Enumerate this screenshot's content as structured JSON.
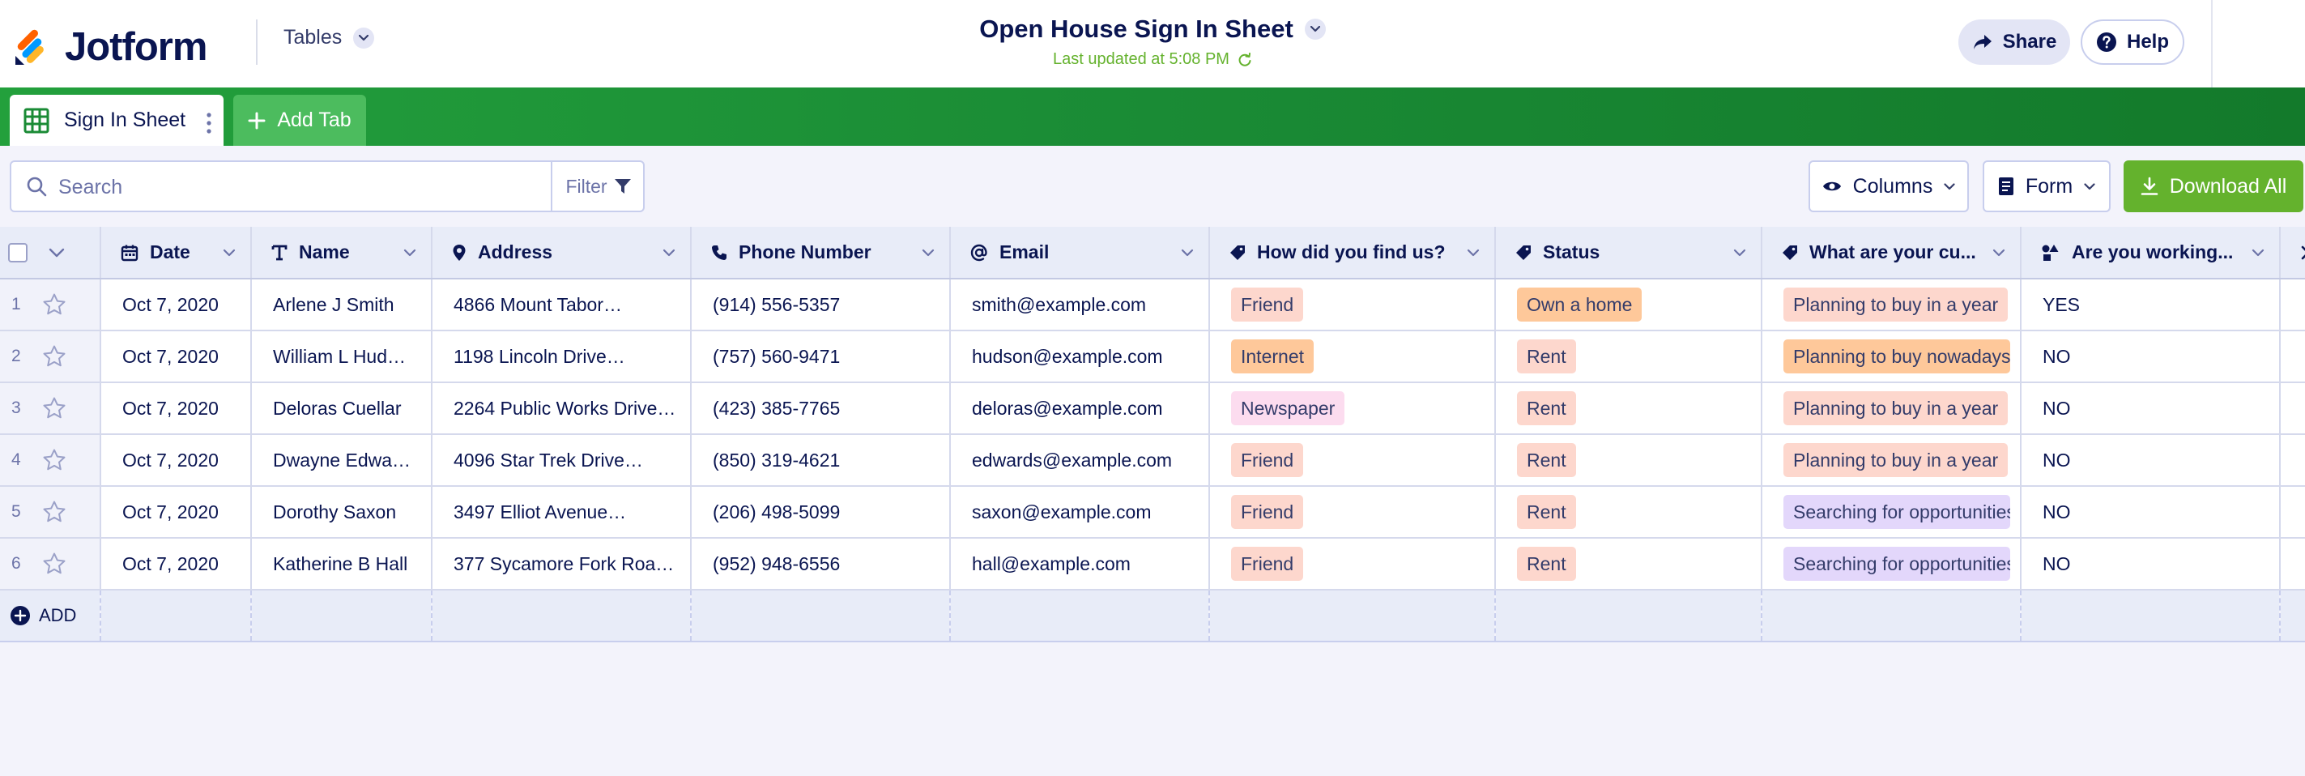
{
  "header": {
    "brand": "Jotform",
    "app_menu": "Tables",
    "title": "Open House Sign In Sheet",
    "last_updated": "Last updated at 5:08 PM",
    "share_label": "Share",
    "help_label": "Help"
  },
  "tabs": {
    "items": [
      {
        "label": "Sign In Sheet",
        "icon": "table-grid-icon"
      }
    ],
    "add_label": "Add Tab"
  },
  "toolbar": {
    "search_placeholder": "Search",
    "filter_label": "Filter",
    "columns_label": "Columns",
    "form_label": "Form",
    "download_label": "Download All"
  },
  "table": {
    "columns": [
      {
        "label": "Date",
        "icon": "calendar-icon"
      },
      {
        "label": "Name",
        "icon": "text-icon"
      },
      {
        "label": "Address",
        "icon": "map-pin-icon"
      },
      {
        "label": "Phone Number",
        "icon": "phone-icon"
      },
      {
        "label": "Email",
        "icon": "at-sign-icon"
      },
      {
        "label": "How did you find us?",
        "icon": "tag-icon"
      },
      {
        "label": "Status",
        "icon": "tag-icon"
      },
      {
        "label": "What are your cu...",
        "icon": "tag-icon"
      },
      {
        "label": "Are you working...",
        "icon": "shapes-icon"
      }
    ],
    "rows": [
      {
        "num": "1",
        "date": "Oct 7, 2020",
        "name": "Arlene J Smith",
        "address": "4866 Mount Tabor…",
        "phone": "(914) 556-5357",
        "email": "smith@example.com",
        "found": "Friend",
        "status": "Own a home",
        "current": "Planning to buy in a year",
        "working": "YES"
      },
      {
        "num": "2",
        "date": "Oct 7, 2020",
        "name": "William L Hud…",
        "address": "1198 Lincoln Drive…",
        "phone": "(757) 560-9471",
        "email": "hudson@example.com",
        "found": "Internet",
        "status": "Rent",
        "current": "Planning to buy nowadays",
        "working": "NO"
      },
      {
        "num": "3",
        "date": "Oct 7, 2020",
        "name": "Deloras Cuellar",
        "address": "2264 Public Works Drive…",
        "phone": "(423) 385-7765",
        "email": "deloras@example.com",
        "found": "Newspaper",
        "status": "Rent",
        "current": "Planning to buy in a year",
        "working": "NO"
      },
      {
        "num": "4",
        "date": "Oct 7, 2020",
        "name": "Dwayne Edwa…",
        "address": "4096 Star Trek Drive…",
        "phone": "(850) 319-4621",
        "email": "edwards@example.com",
        "found": "Friend",
        "status": "Rent",
        "current": "Planning to buy in a year",
        "working": "NO"
      },
      {
        "num": "5",
        "date": "Oct 7, 2020",
        "name": "Dorothy Saxon",
        "address": "3497 Elliot Avenue…",
        "phone": "(206) 498-5099",
        "email": "saxon@example.com",
        "found": "Friend",
        "status": "Rent",
        "current": "Searching for opportunities",
        "working": "NO"
      },
      {
        "num": "6",
        "date": "Oct 7, 2020",
        "name": "Katherine B Hall",
        "address": "377 Sycamore Fork Road…",
        "phone": "(952) 948-6556",
        "email": "hall@example.com",
        "found": "Friend",
        "status": "Rent",
        "current": "Searching for opportunities",
        "working": "NO"
      }
    ],
    "add_label": "ADD"
  },
  "tag_colors": {
    "Friend": "#fdd7cd",
    "Internet": "#fec89a",
    "Newspaper": "#fcdcef",
    "Own a home": "#fec89a",
    "Rent": "#fdd7cd",
    "Planning to buy in a year": "#fdd7cd",
    "Planning to buy nowadays": "#fec89a",
    "Searching for opportunities": "#e3d7fb"
  },
  "colors": {
    "brand_green": "#1a8b35",
    "accent_green": "#64b22d",
    "navy": "#0a1551"
  }
}
